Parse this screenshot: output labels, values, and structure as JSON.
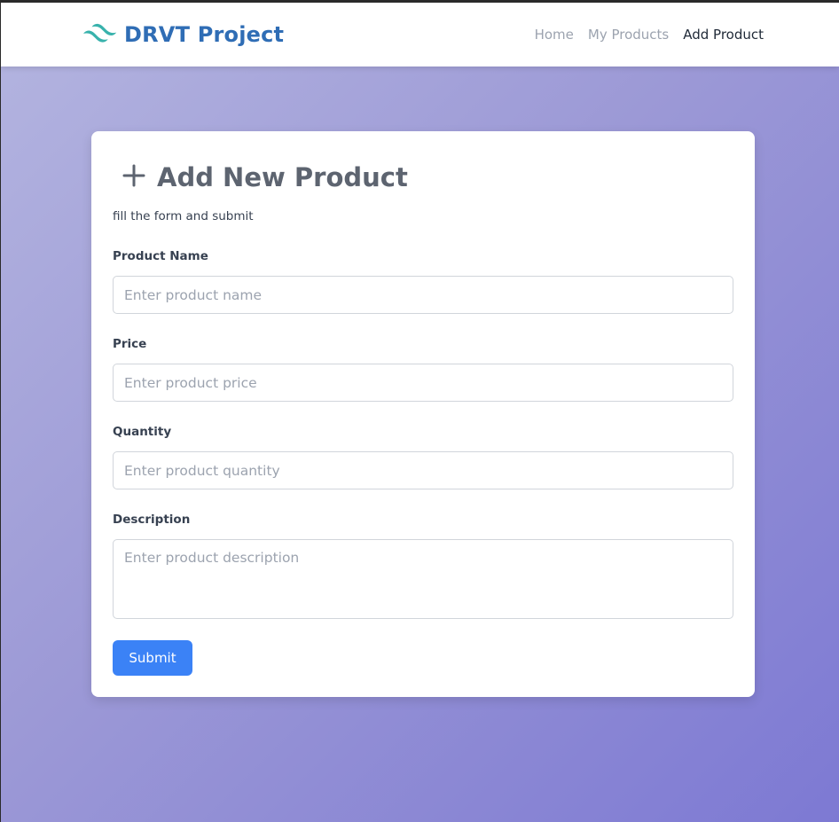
{
  "navbar": {
    "brand_name": "DRVT Project",
    "brand_icon": "wave-logo-icon",
    "links": [
      {
        "label": "Home",
        "active": false
      },
      {
        "label": "My Products",
        "active": false
      },
      {
        "label": "Add Product",
        "active": true
      }
    ]
  },
  "form": {
    "title": "Add New Product",
    "title_icon": "plus-icon",
    "subtitle": "fill the form and submit",
    "fields": {
      "name": {
        "label": "Product Name",
        "placeholder": "Enter product name",
        "value": ""
      },
      "price": {
        "label": "Price",
        "placeholder": "Enter product price",
        "value": ""
      },
      "quantity": {
        "label": "Quantity",
        "placeholder": "Enter product quantity",
        "value": ""
      },
      "description": {
        "label": "Description",
        "placeholder": "Enter product description",
        "value": ""
      }
    },
    "submit_label": "Submit"
  },
  "colors": {
    "brand": "#2f6db5",
    "logo_teal": "#38b2ac",
    "accent_button": "#3b82f6",
    "background_gradient_start": "#b4b5e0",
    "background_gradient_end": "#7d79d3"
  }
}
